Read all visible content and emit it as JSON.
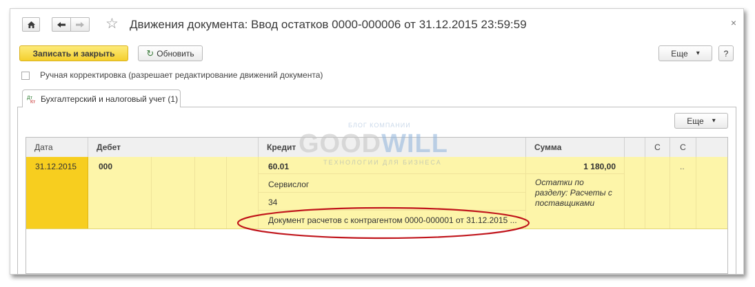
{
  "window": {
    "title": "Движения документа: Ввод остатков 0000-000006 от 31.12.2015 23:59:59",
    "close_glyph": "×"
  },
  "nav": {
    "home_icon": "home-icon",
    "back_glyph": "🡐",
    "forward_glyph": "🡒",
    "star_glyph": "☆"
  },
  "toolbar": {
    "save_close_label": "Записать и закрыть",
    "refresh_label": "Обновить",
    "refresh_glyph": "↻",
    "more_label": "Еще",
    "more_arrow": "▾",
    "help_label": "?"
  },
  "manual_edit": {
    "label": "Ручная корректировка (разрешает редактирование движений документа)",
    "checked": false
  },
  "tabs": [
    {
      "label": "Бухгалтерский и налоговый учет (1)",
      "icon": "ledger-icon",
      "active": true
    }
  ],
  "table_toolbar": {
    "more_label": "Еще",
    "more_arrow": "▾"
  },
  "watermark": {
    "top": "БЛОГ КОМПАНИИ",
    "brand_left": "GOOD",
    "brand_right": "WILL",
    "bottom": "ТЕХНОЛОГИИ ДЛЯ БИЗНЕСА"
  },
  "table": {
    "headers": {
      "date": "Дата",
      "debit": "Дебет",
      "credit": "Кредит",
      "amount": "Сумма",
      "c1": "С",
      "c2": "С"
    },
    "rows": [
      {
        "date": "31.12.2015",
        "debit_account": "000",
        "credit_account": "60.01",
        "credit_subconto1": "Сервислог",
        "credit_subconto2": "34",
        "credit_subconto3": "Документ расчетов с контрагентом 0000-000001 от 31.12.2015 ...",
        "amount": "1 180,00",
        "content_line1": "Остатки по",
        "content_line2": "разделу: Расчеты с",
        "content_line3": "поставщиками",
        "c2_value": ".."
      }
    ]
  },
  "highlight_color": "#c0141b"
}
